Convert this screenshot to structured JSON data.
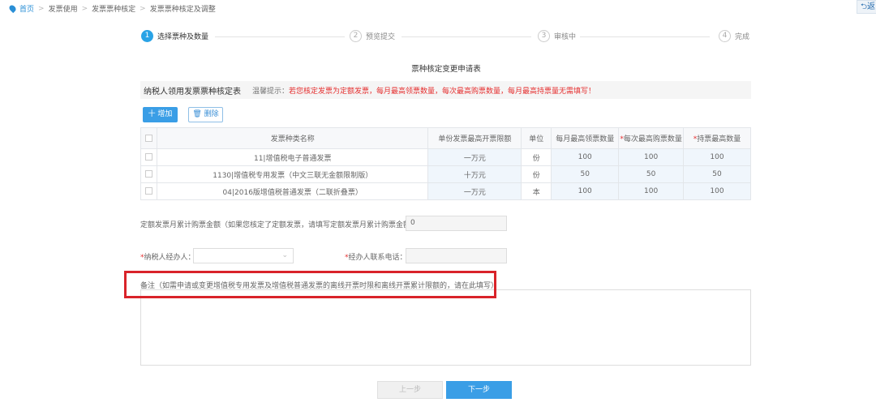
{
  "breadcrumb": [
    "首页",
    "发票使用",
    "发票票种核定",
    "发票票种核定及调整"
  ],
  "return_label": "返",
  "steps": [
    {
      "num": "1",
      "label": "选择票种及数量"
    },
    {
      "num": "2",
      "label": "预览提交"
    },
    {
      "num": "3",
      "label": "审核中"
    },
    {
      "num": "4",
      "label": "完成"
    }
  ],
  "form_title": "票种核定变更申请表",
  "section": {
    "heading": "纳税人领用发票票种核定表",
    "tip_prefix": "温馨提示：",
    "tip": "若您核定发票为定额发票，每月最高领票数量，每次最高购票数量，每月最高持票量无需填写！"
  },
  "toolbar": {
    "add": "十 增加",
    "delete": "删除"
  },
  "table": {
    "headers": [
      "发票种类名称",
      "单份发票最高开票限额",
      "单位",
      "每月最高领票数量",
      "每次最高购票数量",
      "持票最高数量"
    ],
    "rows": [
      [
        "11|增值税电子普通发票",
        "一万元",
        "份",
        "100",
        "100",
        "100"
      ],
      [
        "1130|增值税专用发票（中文三联无金额限制版）",
        "十万元",
        "份",
        "50",
        "50",
        "50"
      ],
      [
        "04|2016版增值税普通发票（二联折叠票）",
        "一万元",
        "本",
        "100",
        "100",
        "100"
      ]
    ]
  },
  "fields": {
    "quota_label": "定额发票月累计购票金额（如果您核定了定额发票，请填写定额发票月累计购票金额）：",
    "quota_value": "0",
    "agent_label": "纳税人经办人：",
    "agent_value": "",
    "phone_label": "经办人联系电话：",
    "phone_value": "",
    "remark_label": "备注（如需申请或变更增值税专用发票及增值税普通发票的离线开票时限和离线开票累计限额的，请在此填写）",
    "remark_value": ""
  },
  "buttons": {
    "prev": "上一步",
    "next": "下一步"
  },
  "colors": {
    "accent": "#3a9ee6",
    "warning": "#e53030",
    "highlight_box": "#d9232a"
  }
}
